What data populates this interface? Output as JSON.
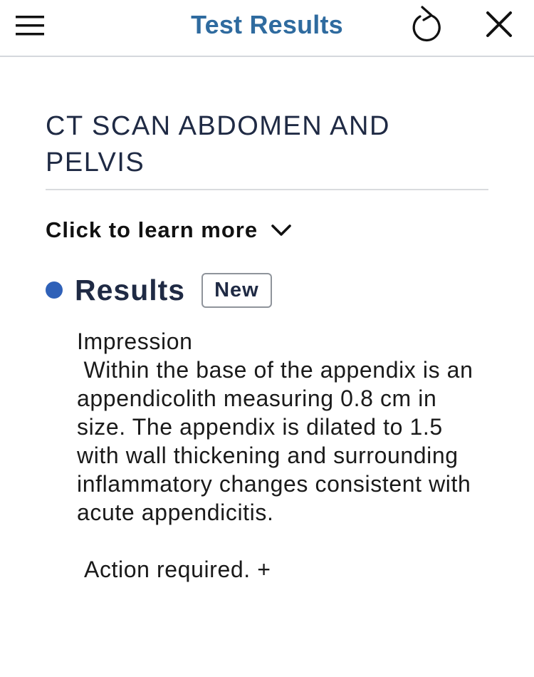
{
  "header": {
    "title": "Test Results",
    "menu_icon": "hamburger-icon",
    "refresh_icon": "refresh-icon",
    "close_icon": "close-icon",
    "title_color": "#2f6b9f"
  },
  "test": {
    "name": "CT SCAN ABDOMEN AND PELVIS",
    "learn_more_label": "Click to learn more"
  },
  "results": {
    "label": "Results",
    "badge": "New",
    "dot_color": "#2f61b8",
    "report_text": "Impression\n Within the base of the appendix is an appendicolith measuring 0.8 cm in size. The appendix is dilated to 1.5 with wall thickening and surrounding inflammatory changes consistent with acute appendicitis.",
    "action_text": "Action required. +"
  }
}
